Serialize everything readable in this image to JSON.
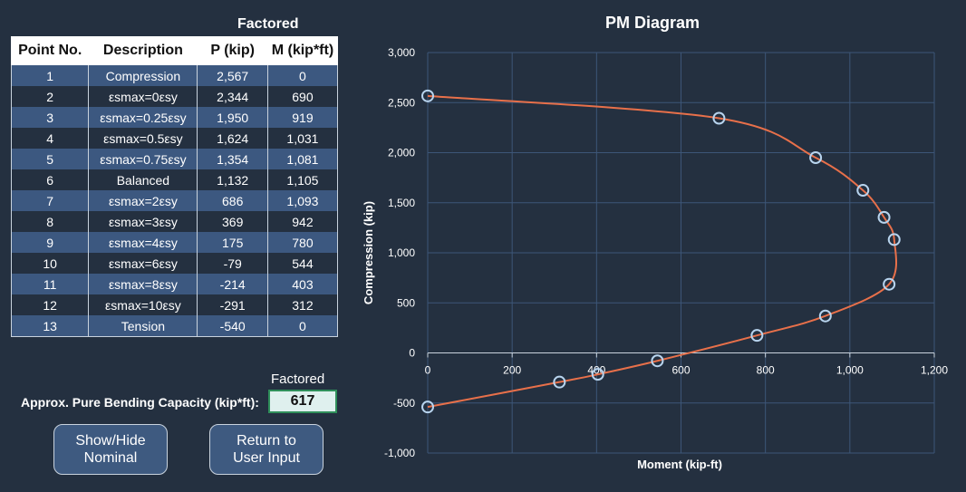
{
  "table": {
    "group_header": "Factored",
    "headers": [
      "Point No.",
      "Description",
      "P (kip)",
      "M (kip*ft)"
    ],
    "rows": [
      [
        "1",
        "Compression",
        "2,567",
        "0"
      ],
      [
        "2",
        "εsmax=0εsy",
        "2,344",
        "690"
      ],
      [
        "3",
        "εsmax=0.25εsy",
        "1,950",
        "919"
      ],
      [
        "4",
        "εsmax=0.5εsy",
        "1,624",
        "1,031"
      ],
      [
        "5",
        "εsmax=0.75εsy",
        "1,354",
        "1,081"
      ],
      [
        "6",
        "Balanced",
        "1,132",
        "1,105"
      ],
      [
        "7",
        "εsmax=2εsy",
        "686",
        "1,093"
      ],
      [
        "8",
        "εsmax=3εsy",
        "369",
        "942"
      ],
      [
        "9",
        "εsmax=4εsy",
        "175",
        "780"
      ],
      [
        "10",
        "εsmax=6εsy",
        "-79",
        "544"
      ],
      [
        "11",
        "εsmax=8εsy",
        "-214",
        "403"
      ],
      [
        "12",
        "εsmax=10εsy",
        "-291",
        "312"
      ],
      [
        "13",
        "Tension",
        "-540",
        "0"
      ]
    ]
  },
  "bending": {
    "factored_label": "Factored",
    "label": "Approx. Pure Bending Capacity (kip*ft):",
    "value": "617"
  },
  "buttons": {
    "show_hide_nominal": "Show/Hide\nNominal",
    "return_to_user_input": "Return to\nUser Input"
  },
  "colors": {
    "background": "#243040",
    "row_alt": "#3c5880",
    "curve": "#e8704a",
    "marker": "#b8d4ee",
    "grid": "#3d5678"
  },
  "chart_data": {
    "type": "scatter",
    "title": "PM Diagram",
    "xlabel": "Moment (kip-ft)",
    "ylabel": "Compression (kip)",
    "xlim": [
      0,
      1200
    ],
    "ylim": [
      -1000,
      3000
    ],
    "x_ticks": [
      "0",
      "200",
      "400",
      "600",
      "800",
      "1,000",
      "1,200"
    ],
    "y_ticks": [
      "-1,000",
      "-500",
      "0",
      "500",
      "1,000",
      "1,500",
      "2,000",
      "2,500",
      "3,000"
    ],
    "x_tick_values": [
      0,
      200,
      400,
      600,
      800,
      1000,
      1200
    ],
    "y_tick_values": [
      -1000,
      -500,
      0,
      500,
      1000,
      1500,
      2000,
      2500,
      3000
    ],
    "grid": true,
    "series": [
      {
        "points": [
          [
            0,
            2567
          ],
          [
            690,
            2344
          ],
          [
            919,
            1950
          ],
          [
            1031,
            1624
          ],
          [
            1081,
            1354
          ],
          [
            1105,
            1132
          ],
          [
            1093,
            686
          ],
          [
            942,
            369
          ],
          [
            780,
            175
          ],
          [
            544,
            -79
          ],
          [
            403,
            -214
          ],
          [
            312,
            -291
          ],
          [
            0,
            -540
          ]
        ]
      }
    ]
  }
}
